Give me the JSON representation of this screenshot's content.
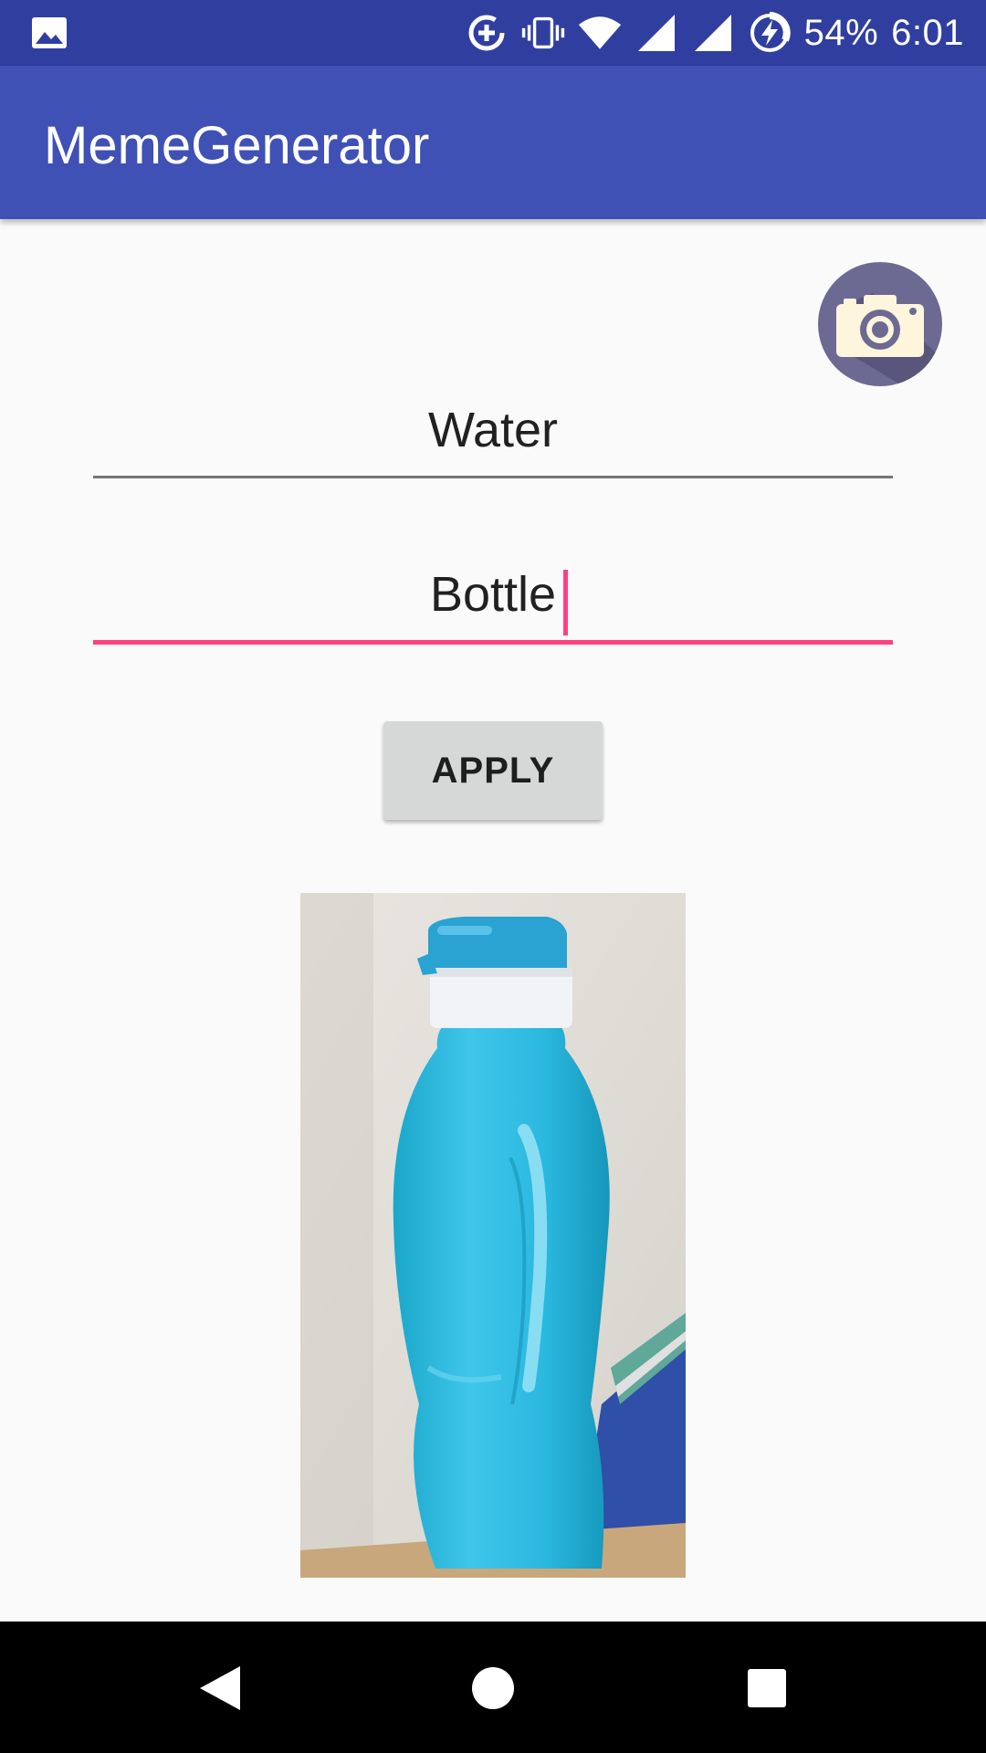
{
  "status_bar": {
    "battery": "54%",
    "time": "6:01",
    "icons": [
      "image-notification-icon",
      "data-saver-icon",
      "vibrate-icon",
      "wifi-icon",
      "signal-icon",
      "signal-icon",
      "battery-charging-icon"
    ]
  },
  "app_bar": {
    "title": "MemeGenerator"
  },
  "form": {
    "top_text": "Water",
    "bottom_text": "Bottle",
    "apply_label": "APPLY"
  },
  "colors": {
    "status_bar": "#303f9f",
    "app_bar": "#3f51b5",
    "accent": "#ff4081",
    "fab": "#6c6a93"
  },
  "nav": {
    "icons": [
      "back-icon",
      "home-icon",
      "recents-icon"
    ]
  }
}
